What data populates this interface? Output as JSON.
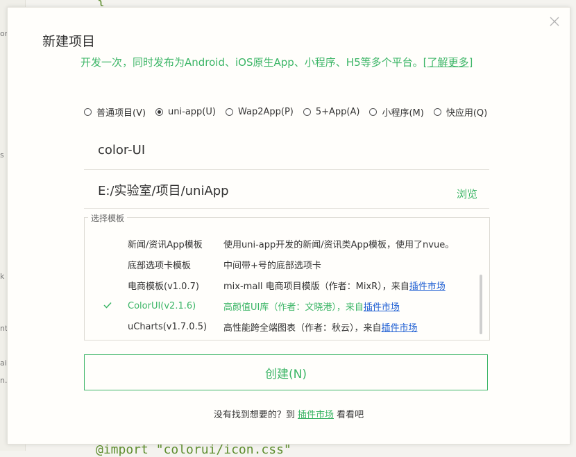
{
  "background": {
    "gutter_labels": [
      "or",
      "s",
      "k",
      "nt",
      "ail",
      "n..."
    ],
    "code_top": "{",
    "code_bottom": "@import \"colorui/icon.css\""
  },
  "dialog": {
    "title": "新建项目",
    "subtitle": "开发一次，同时发布为Android、iOS原生App、小程序、H5等多个平台。",
    "learn_more": "[了解更多]",
    "project_types": [
      {
        "label": "普通项目(V)",
        "checked": false
      },
      {
        "label": "uni-app(U)",
        "checked": true
      },
      {
        "label": "Wap2App(P)",
        "checked": false
      },
      {
        "label": "5+App(A)",
        "checked": false
      },
      {
        "label": "小程序(M)",
        "checked": false
      },
      {
        "label": "快应用(Q)",
        "checked": false
      }
    ],
    "project_name": "color-UI",
    "project_path": "E:/实验室/项目/uniApp",
    "browse": "浏览",
    "template_legend": "选择模板",
    "templates": [
      {
        "name": "新闻/资讯App模板",
        "desc": "使用uni-app开发的新闻/资讯类App模板，使用了nvue。",
        "link": ""
      },
      {
        "name": "底部选项卡模板",
        "desc": "中间带+号的底部选项卡",
        "link": ""
      },
      {
        "name": "电商模板(v1.0.7)",
        "desc": "mix-mall 电商项目模版（作者：MixR），来自",
        "link": "插件市场"
      },
      {
        "name": "ColorUI(v2.1.6)",
        "desc": "高颜值UI库（作者：文晓港），来自",
        "link": "插件市场"
      },
      {
        "name": "uCharts(v1.7.0.5)",
        "desc": "高性能跨全端图表（作者：秋云），来自",
        "link": "插件市场"
      }
    ],
    "create_button": "创建(N)",
    "footer_prefix": "没有找到想要的？到 ",
    "footer_link": "插件市场",
    "footer_suffix": " 看看吧"
  },
  "colors": {
    "accent": "#3bb566",
    "link_blue": "#1e5ed3"
  }
}
